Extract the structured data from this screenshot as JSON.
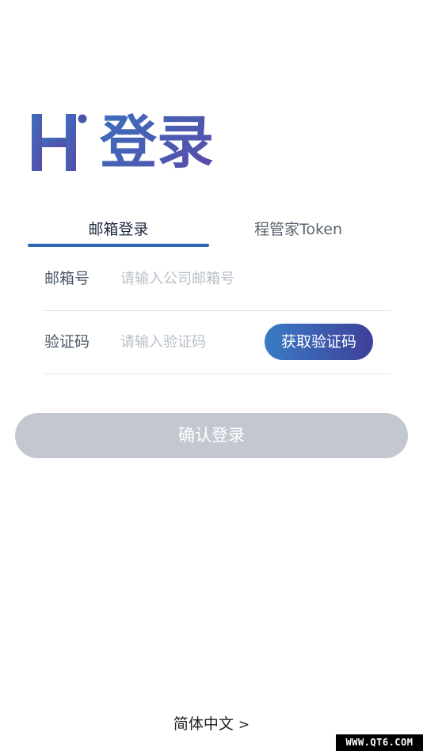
{
  "header": {
    "logo_text": "H",
    "title": "登录",
    "brand_colors": [
      "#3b6fc0",
      "#5a4aa6"
    ]
  },
  "tabs": [
    {
      "label": "邮箱登录",
      "active": true
    },
    {
      "label": "程管家Token",
      "active": false
    }
  ],
  "form": {
    "email_label": "邮箱号",
    "email_placeholder": "请输入公司邮箱号",
    "code_label": "验证码",
    "code_placeholder": "请输入验证码",
    "get_code_label": "获取验证码"
  },
  "login_button": {
    "label": "确认登录",
    "enabled": false
  },
  "language": {
    "label": "简体中文"
  },
  "watermark": "WWW.QT6.COM",
  "colors": {
    "accent": "#2e67b0",
    "disabled": "#c3c8d0"
  }
}
